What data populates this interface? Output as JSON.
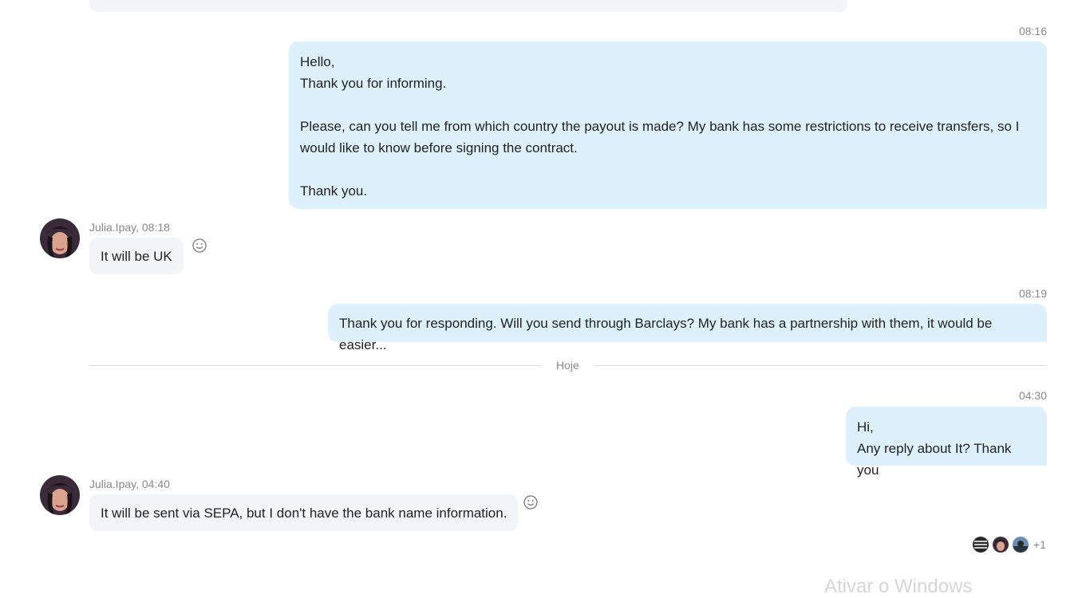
{
  "messages": [
    {
      "time": "08:16",
      "text": "Hello,\nThank you for informing.\n\nPlease, can you tell me from which country the payout is made? My bank has some restrictions to receive transfers, so I would like to know before signing the contract.\n\nThank you."
    },
    {
      "sender": "Julia.Ipay, 08:18",
      "text": "It will be UK"
    },
    {
      "time": "08:19",
      "text": "Thank you for responding. Will you send through Barclays? My bank has a partnership with them, it would be easier..."
    },
    {
      "time": "04:30",
      "text": "Hi,\nAny reply about It? Thank you"
    },
    {
      "sender": "Julia.Ipay, 04:40",
      "text": "It will be sent via SEPA, but I don't have the bank name information."
    }
  ],
  "divider": {
    "label": "Hoje"
  },
  "seen_by": {
    "extra": "+1"
  },
  "watermark": "Ativar o Windows"
}
